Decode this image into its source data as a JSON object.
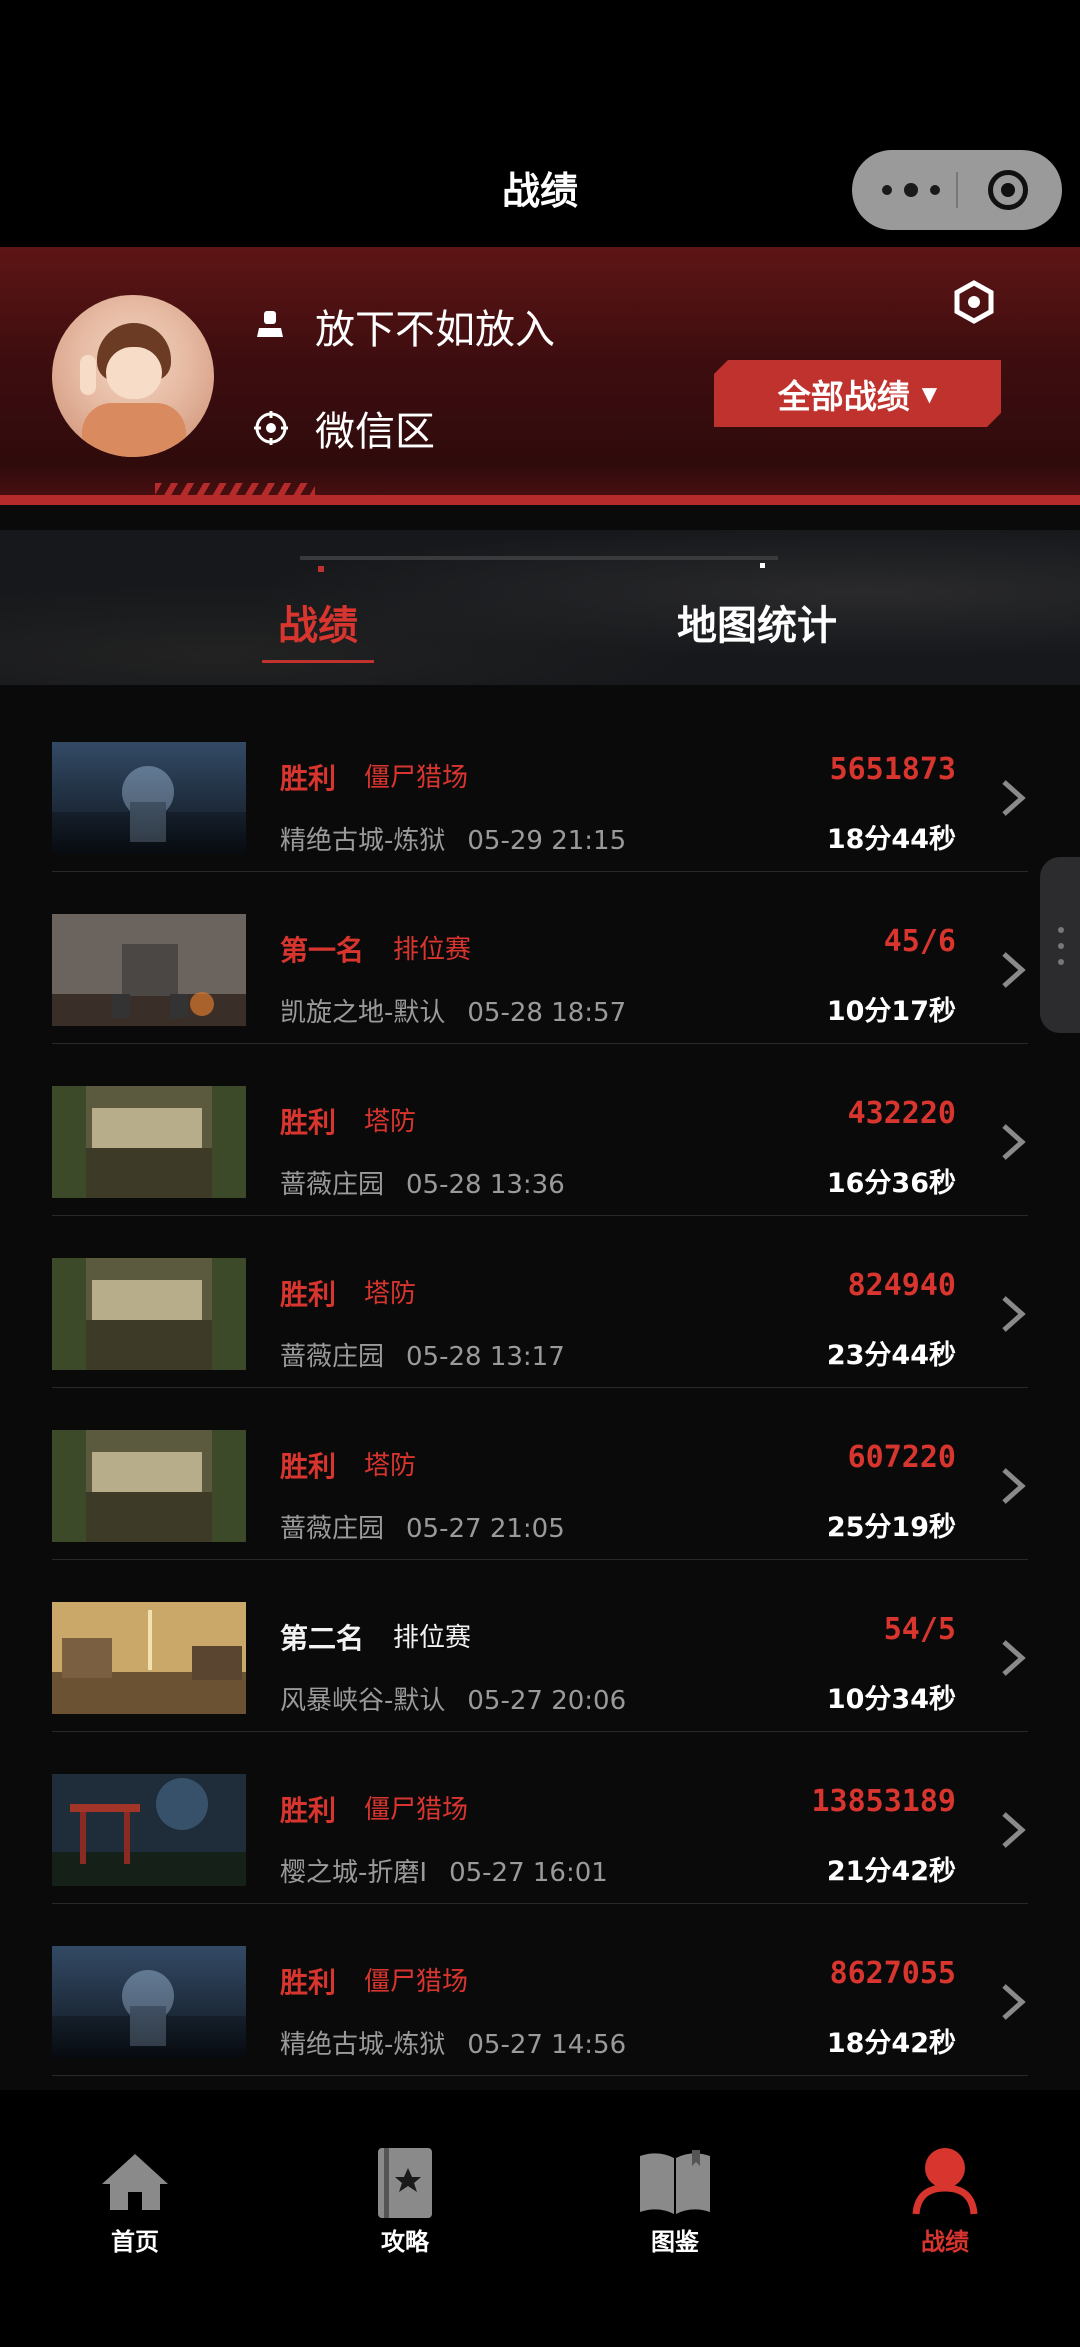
{
  "header": {
    "title": "战绩"
  },
  "profile": {
    "name": "放下不如放入",
    "server": "微信区",
    "filter_button": "全部战绩",
    "filter_caret": "▼"
  },
  "tabs": [
    {
      "label": "战绩",
      "active": true
    },
    {
      "label": "地图统计",
      "active": false
    }
  ],
  "records": [
    {
      "result": "胜利",
      "mode": "僵尸猎场",
      "map": "精绝古城-炼狱",
      "time": "05-29 21:15",
      "score": "5651873",
      "duration": "18分44秒",
      "thumb": "tomb"
    },
    {
      "result": "第一名",
      "mode": "排位赛",
      "map": "凯旋之地-默认",
      "time": "05-28 18:57",
      "score": "45/6",
      "duration": "10分17秒",
      "thumb": "mech"
    },
    {
      "result": "胜利",
      "mode": "塔防",
      "map": "蔷薇庄园",
      "time": "05-28 13:36",
      "score": "432220",
      "duration": "16分36秒",
      "thumb": "manor"
    },
    {
      "result": "胜利",
      "mode": "塔防",
      "map": "蔷薇庄园",
      "time": "05-28 13:17",
      "score": "824940",
      "duration": "23分44秒",
      "thumb": "manor"
    },
    {
      "result": "胜利",
      "mode": "塔防",
      "map": "蔷薇庄园",
      "time": "05-27 21:05",
      "score": "607220",
      "duration": "25分19秒",
      "thumb": "manor"
    },
    {
      "result": "第二名",
      "mode": "排位赛",
      "map": "风暴峡谷-默认",
      "time": "05-27 20:06",
      "score": "54/5",
      "duration": "10分34秒",
      "thumb": "canyon"
    },
    {
      "result": "胜利",
      "mode": "僵尸猎场",
      "map": "樱之城-折磨I",
      "time": "05-27 16:01",
      "score": "13853189",
      "duration": "21分42秒",
      "thumb": "sakura"
    },
    {
      "result": "胜利",
      "mode": "僵尸猎场",
      "map": "精绝古城-炼狱",
      "time": "05-27 14:56",
      "score": "8627055",
      "duration": "18分42秒",
      "thumb": "tomb"
    }
  ],
  "nav": [
    {
      "label": "首页",
      "icon": "home-icon",
      "active": false
    },
    {
      "label": "攻略",
      "icon": "guide-book-icon",
      "active": false
    },
    {
      "label": "图鉴",
      "icon": "open-book-icon",
      "active": false
    },
    {
      "label": "战绩",
      "icon": "user-icon",
      "active": true
    }
  ],
  "colors": {
    "accent": "#d9352f",
    "bg": "#0a0a0b",
    "profile_bg": "#4a1012"
  }
}
